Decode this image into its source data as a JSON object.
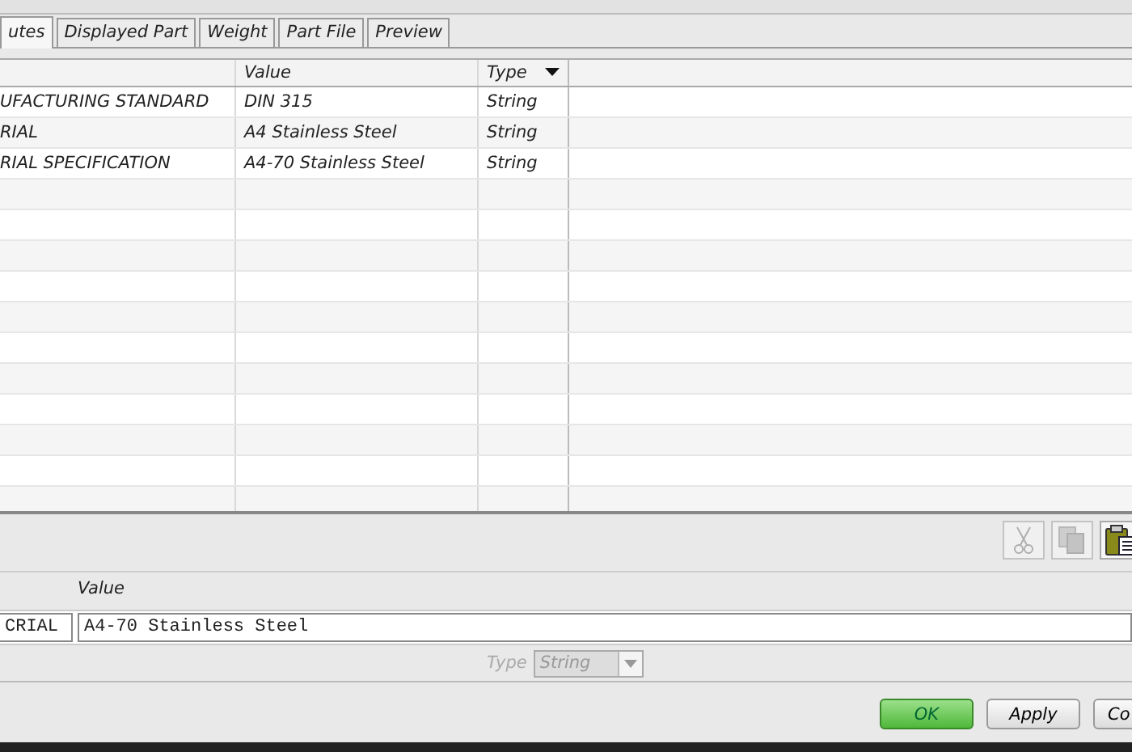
{
  "tabs": [
    {
      "label": "utes",
      "selected": true
    },
    {
      "label": "Displayed Part",
      "selected": false
    },
    {
      "label": "Weight",
      "selected": false
    },
    {
      "label": "Part File",
      "selected": false
    },
    {
      "label": "Preview",
      "selected": false
    }
  ],
  "table": {
    "columns": [
      "Value",
      "Type"
    ],
    "rows": [
      {
        "name": "UFACTURING STANDARD",
        "value": "DIN 315",
        "type": "String"
      },
      {
        "name": "RIAL",
        "value": "A4 Stainless Steel",
        "type": "String"
      },
      {
        "name": "RIAL SPECIFICATION",
        "value": "A4-70 Stainless Steel",
        "type": "String"
      }
    ]
  },
  "toolbar": [
    {
      "kind": "cut",
      "disabled": true
    },
    {
      "kind": "copy",
      "disabled": true
    },
    {
      "kind": "paste",
      "disabled": false
    }
  ],
  "editor": {
    "value_label": "Value",
    "name_value": "CRIAL",
    "value": "A4-70 Stainless Steel",
    "type_label": "Type",
    "type_value": "String",
    "type_disabled": true
  },
  "buttons": [
    {
      "label": "OK",
      "primary": true
    },
    {
      "label": "Apply",
      "primary": false
    },
    {
      "label": "Co",
      "primary": false
    }
  ]
}
